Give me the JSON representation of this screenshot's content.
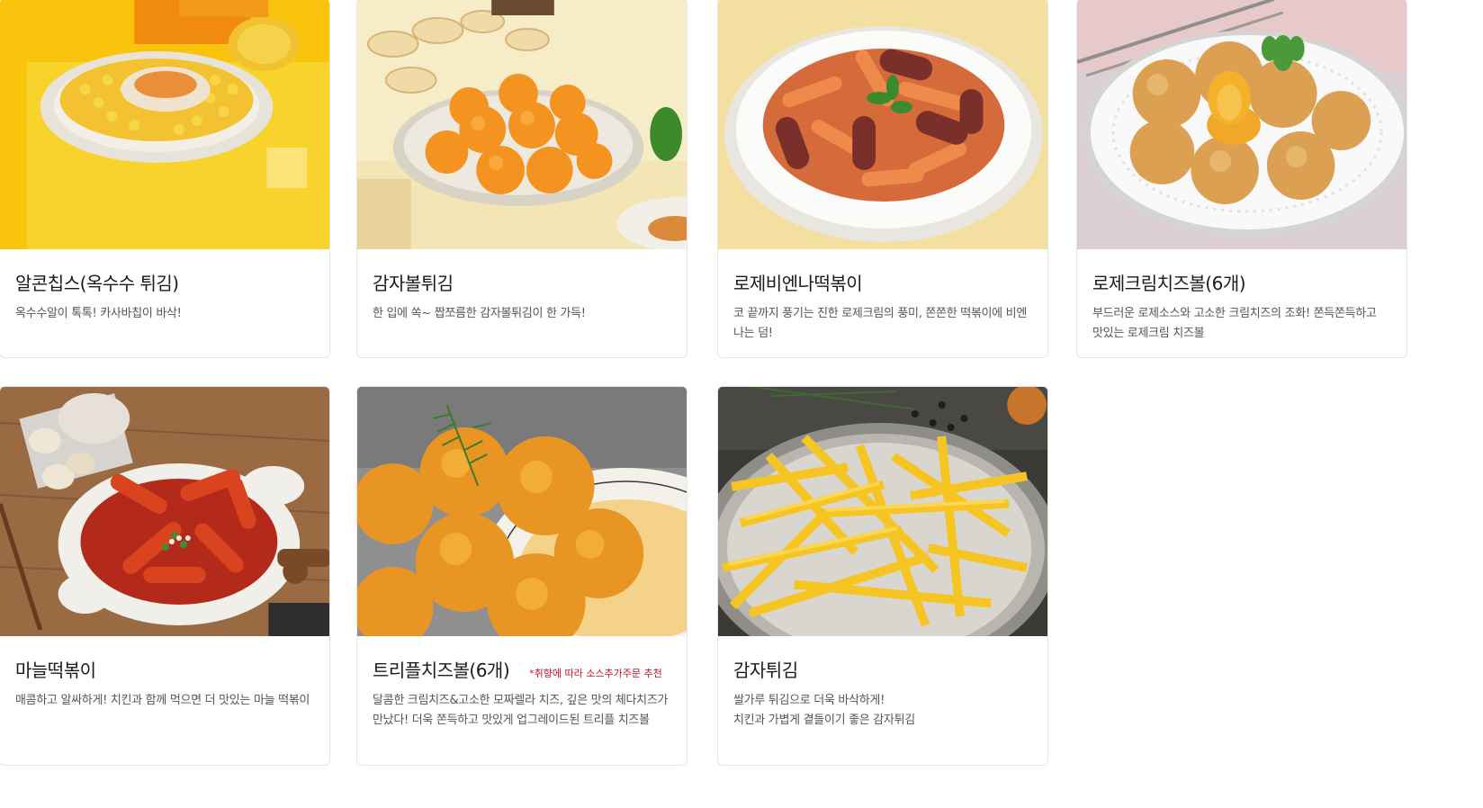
{
  "menu": {
    "items": [
      {
        "name": "알콘칩스(옥수수 튀김)",
        "note": "",
        "desc_lines": [
          "옥수수알이 톡톡! 카사바칩이 바삭!"
        ],
        "image": "corn-chips-photo"
      },
      {
        "name": "감자볼튀김",
        "note": "",
        "desc_lines": [
          "한 입에 쏙~ 짭쪼름한 감자볼튀김이 한 가득!"
        ],
        "image": "potato-ball-photo"
      },
      {
        "name": "로제비엔나떡볶이",
        "note": "",
        "desc_lines": [
          "코 끝까지 풍기는 진한 로제크림의 풍미, 쫀쫀한 떡볶이에 비엔나는 덤!"
        ],
        "image": "rose-vienna-tteokbokki-photo"
      },
      {
        "name": "로제크림치즈볼(6개)",
        "note": "",
        "desc_lines": [
          "부드러운 로제소스와 고소한 크림치즈의 조화! 쫀득쫀득하고 맛있는 로제크림 치즈볼"
        ],
        "image": "rose-cream-cheese-ball-photo"
      },
      {
        "name": "마늘떡볶이",
        "note": "",
        "desc_lines": [
          "매콤하고 알싸하게! 치킨과 함께 먹으면 더 맛있는 마늘 떡볶이"
        ],
        "image": "garlic-tteokbokki-photo"
      },
      {
        "name": "트리플치즈볼(6개)",
        "note": "*취향에 따라 소스추가주문 추천",
        "desc_lines": [
          "달콤한 크림치즈&고소한 모짜렐라 치즈, 깊은 맛의 체다치즈가",
          "만났다! 더욱 쫀득하고 맛있게 업그레이드된 트리플 치즈볼"
        ],
        "image": "triple-cheese-ball-photo"
      },
      {
        "name": "감자튀김",
        "note": "",
        "desc_lines": [
          "쌀가루 튀김으로 더욱 바삭하게!",
          "치킨과 가볍게 곁들이기 좋은 감자튀김"
        ],
        "image": "french-fries-photo"
      }
    ]
  }
}
